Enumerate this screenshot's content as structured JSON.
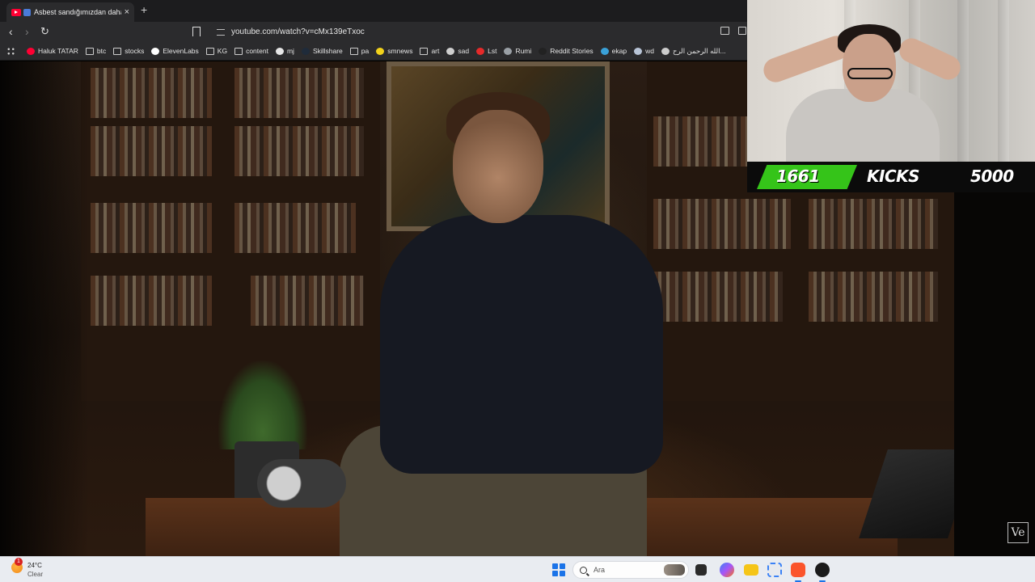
{
  "browser": {
    "tab": {
      "title": "Asbest sandığımızdan daha b",
      "close_icon": "×"
    },
    "new_tab_icon": "+",
    "nav": {
      "back_icon": "‹",
      "forward_icon": "›",
      "reload_icon": "↻"
    },
    "url": "youtube.com/watch?v=cMx139eTxoc"
  },
  "bookmarks": [
    {
      "label": "Haluk TATAR",
      "icon": "youtube-icon",
      "color": "#ff0033"
    },
    {
      "label": "btc",
      "icon": "folder-icon"
    },
    {
      "label": "stocks",
      "icon": "folder-icon"
    },
    {
      "label": "ElevenLabs",
      "icon": "elevenlabs-icon",
      "color": "#ffffff"
    },
    {
      "label": "KG",
      "icon": "folder-icon"
    },
    {
      "label": "content",
      "icon": "folder-icon"
    },
    {
      "label": "mj",
      "icon": "github-icon",
      "color": "#e6e6e6"
    },
    {
      "label": "Skillshare",
      "icon": "skillshare-icon",
      "color": "#1f2b3a"
    },
    {
      "label": "pa",
      "icon": "folder-icon"
    },
    {
      "label": "smnews",
      "icon": "smiley-icon",
      "color": "#f2d21b"
    },
    {
      "label": "art",
      "icon": "folder-icon"
    },
    {
      "label": "sad",
      "icon": "slash-icon",
      "color": "#cfcfcf"
    },
    {
      "label": "Lst",
      "icon": "s-icon",
      "color": "#e62a2a"
    },
    {
      "label": "Rumi",
      "icon": "globe-icon",
      "color": "#9aa0a6"
    },
    {
      "label": "Reddit Stories",
      "icon": "d-icon",
      "color": "#222222"
    },
    {
      "label": "ekap",
      "icon": "ekap-icon",
      "color": "#3aa1d8"
    },
    {
      "label": "wd",
      "icon": "wd-icon",
      "color": "#b8c4d6"
    },
    {
      "label": "الله الرحمن الرح...",
      "icon": "page-icon",
      "color": "#cccccc"
    }
  ],
  "overlay": {
    "kicks_current": "1661",
    "kicks_label": "KICKS",
    "kicks_goal": "5000",
    "accent": "#35c419"
  },
  "video": {
    "watermark": "Ve"
  },
  "taskbar": {
    "weather_badge": "1",
    "temperature": "24°C",
    "condition": "Clear",
    "search_placeholder": "Ara",
    "accent": "#1a73e8"
  }
}
